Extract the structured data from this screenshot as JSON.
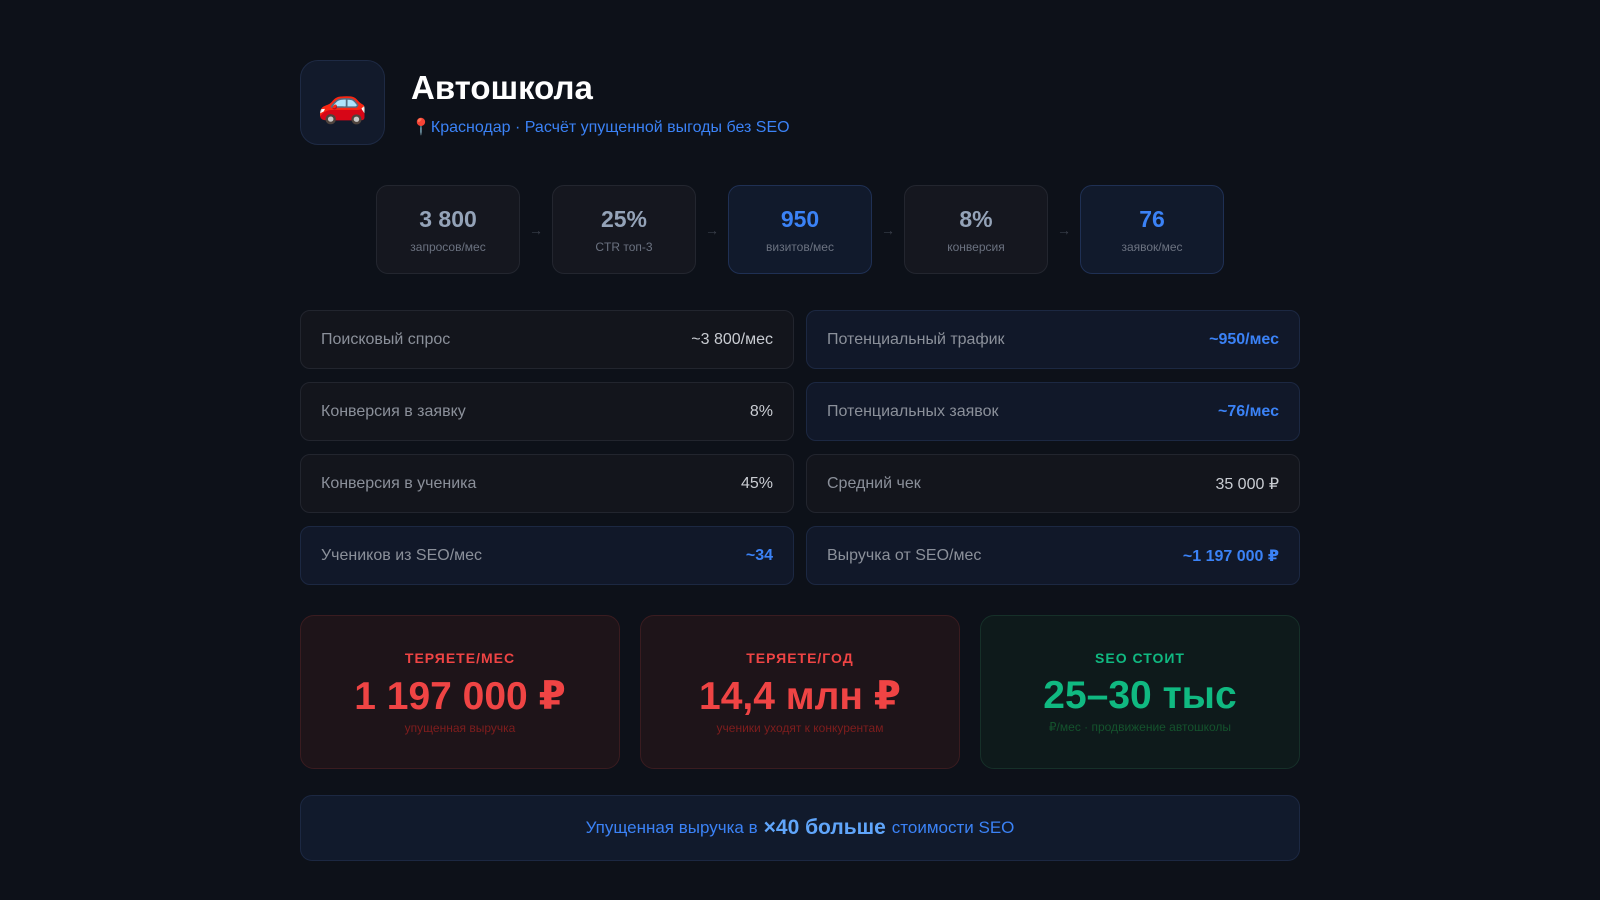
{
  "header": {
    "icon": "car-icon",
    "title": "Автошкола",
    "pin": "📍",
    "subtitle": "Краснодар · Расчёт упущенной выгоды без SEO"
  },
  "funnel": [
    {
      "value": "3 800",
      "label": "запросов/мес"
    },
    {
      "value": "25%",
      "label": "CTR топ-3"
    },
    {
      "value": "950",
      "label": "визитов/мес"
    },
    {
      "value": "8%",
      "label": "конверсия"
    },
    {
      "value": "76",
      "label": "заявок/мес"
    }
  ],
  "metrics": [
    {
      "label": "Поисковый спрос",
      "value": "~3 800/мес"
    },
    {
      "label": "Потенциальный трафик",
      "value": "~950/мес"
    },
    {
      "label": "Конверсия в заявку",
      "value": "8%"
    },
    {
      "label": "Потенциальных заявок",
      "value": "~76/мес"
    },
    {
      "label": "Конверсия в ученика",
      "value": "45%"
    },
    {
      "label": "Средний чек",
      "value": "35 000 ₽"
    },
    {
      "label": "Учеников из SEO/мес",
      "value": "~34"
    },
    {
      "label": "Выручка от SEO/мес",
      "value": "~1 197 000 ₽"
    }
  ],
  "cards": [
    {
      "title": "ТЕРЯЕТЕ/МЕС",
      "value": "1 197 000 ₽",
      "sub": "упущенная выручка"
    },
    {
      "title": "ТЕРЯЕТЕ/ГОД",
      "value": "14,4 млн ₽",
      "sub": "ученики уходят к конкурентам"
    },
    {
      "title": "SEO СТОИТ",
      "value": "25–30 тыс",
      "sub": "₽/мес · продвижение автошколы"
    }
  ],
  "banner": {
    "pre": "Упущенная выручка в",
    "highlight": "×40 больше",
    "post": "стоимости SEO"
  },
  "colors": {
    "blue": "#3b82f6",
    "red": "#ef4444",
    "green": "#10b981"
  }
}
